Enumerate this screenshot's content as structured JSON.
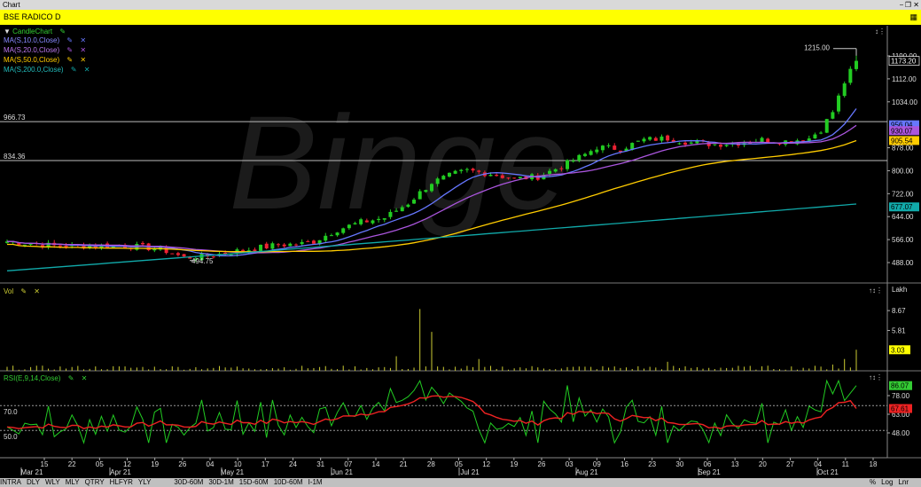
{
  "window": {
    "title": "Chart"
  },
  "header": {
    "symbol_label": "BSE RADICO D"
  },
  "price_pane": {
    "legend": [
      {
        "label": "CandleChart",
        "color": "#33cc33"
      },
      {
        "label": "MA(S,10.0,Close)",
        "color": "#6677ff"
      },
      {
        "label": "MA(S,20.0,Close)",
        "color": "#aa55dd"
      },
      {
        "label": "MA(S,50.0,Close)",
        "color": "#ffcc00"
      },
      {
        "label": "MA(S,200.0,Close)",
        "color": "#11aaaa"
      }
    ],
    "ticks": [
      "1190.00",
      "1112.00",
      "1034.00",
      "878.00",
      "800.00",
      "722.00",
      "644.00",
      "566.00",
      "488.00"
    ],
    "hlines": [
      "966.73",
      "834.36"
    ],
    "annotations": {
      "high": "1215.00",
      "low": "494.75"
    },
    "tags": [
      {
        "text": "1173.20",
        "color": "#ffffff"
      },
      {
        "text": "956.04",
        "color": "#6677ff"
      },
      {
        "text": "930.07",
        "color": "#aa55dd"
      },
      {
        "text": "905.54",
        "color": "#ffcc00"
      },
      {
        "text": "677.07",
        "color": "#11aaaa"
      }
    ],
    "watermark": "Binge"
  },
  "vol_pane": {
    "legend": "Vol",
    "unit": "Lakh",
    "ticks": [
      "8.67",
      "5.81"
    ],
    "tag": "3.03",
    "color": "#cccc33"
  },
  "rsi_pane": {
    "legend": "RSI(E,9,14,Close)",
    "ticks": [
      "78.00",
      "63.00",
      "48.00"
    ],
    "left_levels": [
      "70.0",
      "50.0"
    ],
    "tags": [
      {
        "text": "86.07",
        "color": "#33cc33"
      },
      {
        "text": "67.61",
        "color": "#ee2222"
      }
    ]
  },
  "x_axis": {
    "labels": [
      "15",
      "22",
      "05",
      "12",
      "19",
      "26",
      "04",
      "10",
      "17",
      "24",
      "31",
      "07",
      "14",
      "21",
      "28",
      "05",
      "12",
      "19",
      "26",
      "03",
      "09",
      "16",
      "23",
      "30",
      "06",
      "13",
      "20",
      "27",
      "04",
      "11",
      "18"
    ],
    "months": [
      "Mar 21",
      "Apr 21",
      "May 21",
      "Jun 21",
      "Jul 21",
      "Aug 21",
      "Sep 21",
      "Oct 21"
    ]
  },
  "bottombar": {
    "periods": [
      "INTRA",
      "DLY",
      "WLY",
      "MLY",
      "QTRY",
      "HLFYR",
      "YLY"
    ],
    "intervals": [
      "30D-60M",
      "30D-1M",
      "15D-60M",
      "10D-60M",
      "I-1M"
    ],
    "right": [
      "%",
      "Log",
      "Lnr"
    ]
  }
}
